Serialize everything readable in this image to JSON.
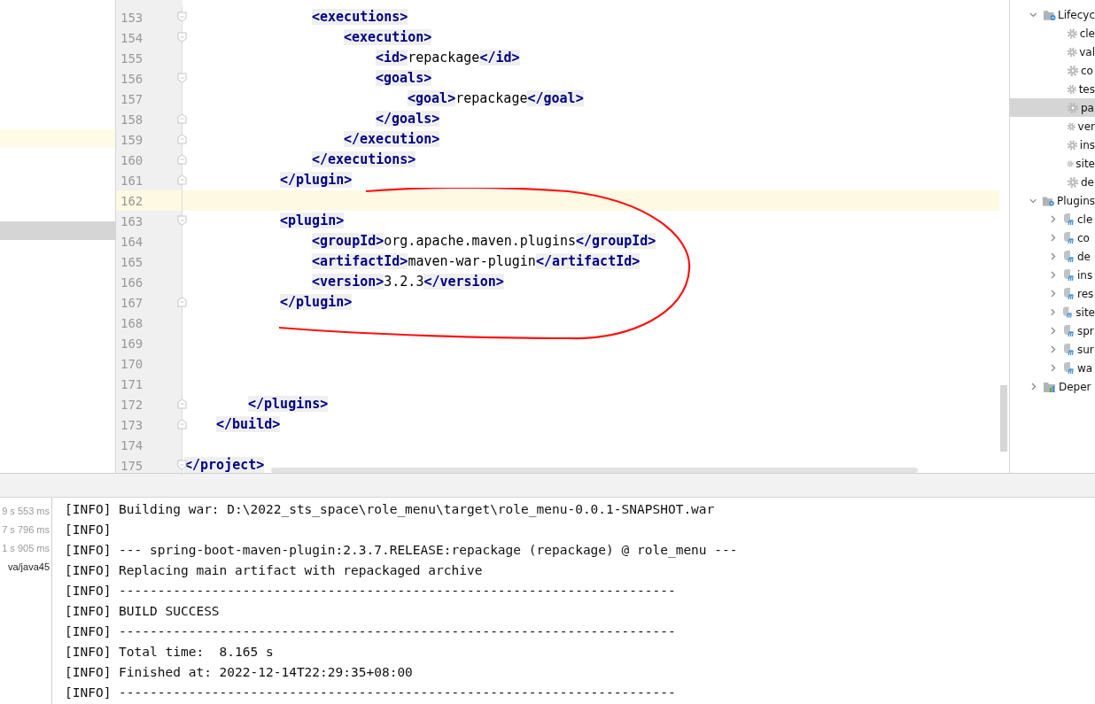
{
  "editor": {
    "lines": [
      {
        "kind": "group",
        "children": [
          {
            "kind": "group",
            "children": [
              {
                "kind": "group",
                "children": [
                  {
                    "kind": "group",
                    "children": [
                      {
                        "kind": "line",
                        "number": "153",
                        "fold_start": true,
                        "fold_end": false,
                        "current": false,
                        "tokens": [
                          {
                            "kind": "tag",
                            "text": "<executions>"
                          }
                        ],
                        "children": [
                          {
                            "kind": "line",
                            "number": "154",
                            "fold_start": true,
                            "fold_end": false,
                            "current": false,
                            "tokens": [
                              {
                                "kind": "tag",
                                "text": "<execution>"
                              }
                            ],
                            "children": [
                              {
                                "kind": "line",
                                "number": "155",
                                "fold_start": false,
                                "fold_end": false,
                                "current": false,
                                "tokens": [
                                  {
                                    "kind": "tag",
                                    "text": "<id>"
                                  },
                                  {
                                    "kind": "text",
                                    "text": "repackage"
                                  },
                                  {
                                    "kind": "tag",
                                    "text": "</id>"
                                  }
                                ]
                              },
                              {
                                "kind": "line",
                                "number": "156",
                                "fold_start": true,
                                "fold_end": false,
                                "current": false,
                                "tokens": [
                                  {
                                    "kind": "tag",
                                    "text": "<goals>"
                                  }
                                ],
                                "children": [
                                  {
                                    "kind": "line",
                                    "number": "157",
                                    "fold_start": false,
                                    "fold_end": false,
                                    "current": false,
                                    "tokens": [
                                      {
                                        "kind": "tag",
                                        "text": "<goal>"
                                      },
                                      {
                                        "kind": "text",
                                        "text": "repackage"
                                      },
                                      {
                                        "kind": "tag",
                                        "text": "</goal>"
                                      }
                                    ]
                                  }
                                ]
                              },
                              {
                                "kind": "line",
                                "number": "158",
                                "fold_start": false,
                                "fold_end": true,
                                "current": false,
                                "tokens": [
                                  {
                                    "kind": "tag",
                                    "text": "</goals>"
                                  }
                                ]
                              }
                            ]
                          },
                          {
                            "kind": "line",
                            "number": "159",
                            "fold_start": false,
                            "fold_end": true,
                            "current": false,
                            "tokens": [
                              {
                                "kind": "tag",
                                "text": "</execution>"
                              }
                            ]
                          }
                        ]
                      },
                      {
                        "kind": "line",
                        "number": "160",
                        "fold_start": false,
                        "fold_end": true,
                        "current": false,
                        "tokens": [
                          {
                            "kind": "tag",
                            "text": "</executions>"
                          }
                        ]
                      }
                    ]
                  },
                  {
                    "kind": "line",
                    "number": "161",
                    "fold_start": false,
                    "fold_end": true,
                    "current": false,
                    "tokens": [
                      {
                        "kind": "tag",
                        "text": "</plugin>"
                      }
                    ]
                  },
                  {
                    "kind": "line",
                    "number": "162",
                    "fold_start": false,
                    "fold_end": false,
                    "current": true
                  },
                  {
                    "kind": "line",
                    "number": "163",
                    "fold_start": true,
                    "fold_end": false,
                    "current": false,
                    "tokens": [
                      {
                        "kind": "tag",
                        "text": "<plugin>"
                      }
                    ],
                    "children": [
                      {
                        "kind": "line",
                        "number": "164",
                        "fold_start": false,
                        "fold_end": false,
                        "current": false,
                        "tokens": [
                          {
                            "kind": "tag",
                            "text": "<groupId>"
                          },
                          {
                            "kind": "text",
                            "text": "org.apache.maven.plugins"
                          },
                          {
                            "kind": "tag",
                            "text": "</groupId>"
                          }
                        ]
                      },
                      {
                        "kind": "line",
                        "number": "165",
                        "fold_start": false,
                        "fold_end": false,
                        "current": false,
                        "tokens": [
                          {
                            "kind": "tag",
                            "text": "<artifactId>"
                          },
                          {
                            "kind": "text",
                            "text": "maven-war-plugin"
                          },
                          {
                            "kind": "tag",
                            "text": "</artifactId>"
                          }
                        ]
                      },
                      {
                        "kind": "line",
                        "number": "166",
                        "fold_start": false,
                        "fold_end": false,
                        "current": false,
                        "tokens": [
                          {
                            "kind": "tag",
                            "text": "<version>"
                          },
                          {
                            "kind": "text",
                            "text": "3.2.3"
                          },
                          {
                            "kind": "tag",
                            "text": "</version>"
                          }
                        ]
                      }
                    ]
                  },
                  {
                    "kind": "line",
                    "number": "167",
                    "fold_start": false,
                    "fold_end": true,
                    "current": false,
                    "tokens": [
                      {
                        "kind": "tag",
                        "text": "</plugin>"
                      }
                    ]
                  },
                  {
                    "kind": "line",
                    "number": "168",
                    "fold_start": false,
                    "fold_end": false,
                    "current": false
                  },
                  {
                    "kind": "line",
                    "number": "169",
                    "fold_start": false,
                    "fold_end": false,
                    "current": false
                  },
                  {
                    "kind": "line",
                    "number": "170",
                    "fold_start": false,
                    "fold_end": false,
                    "current": false
                  },
                  {
                    "kind": "line",
                    "number": "171",
                    "fold_start": false,
                    "fold_end": false,
                    "current": false
                  }
                ]
              },
              {
                "kind": "line",
                "number": "172",
                "fold_start": false,
                "fold_end": true,
                "current": false,
                "tokens": [
                  {
                    "kind": "tag",
                    "text": "</plugins>"
                  }
                ]
              }
            ]
          },
          {
            "kind": "line",
            "number": "173",
            "fold_start": false,
            "fold_end": true,
            "current": false,
            "tokens": [
              {
                "kind": "tag",
                "text": "</build>"
              }
            ]
          },
          {
            "kind": "line",
            "number": "174",
            "fold_start": false,
            "fold_end": false,
            "current": false
          }
        ]
      },
      {
        "kind": "line",
        "number": "175",
        "fold_start": true,
        "fold_end": false,
        "current": false,
        "tokens": [
          {
            "kind": "tag",
            "text": "</project>"
          }
        ]
      }
    ]
  },
  "maven_tree": [
    {
      "label": "Lifecyc",
      "kind": "lifecycle",
      "expanded": true,
      "selected": false,
      "children": [
        {
          "label": "cle",
          "kind": "goal",
          "selected": false
        },
        {
          "label": "val",
          "kind": "goal",
          "selected": false
        },
        {
          "label": "co",
          "kind": "goal",
          "selected": false
        },
        {
          "label": "tes",
          "kind": "goal",
          "selected": false
        },
        {
          "label": "pa",
          "kind": "goal",
          "selected": true
        },
        {
          "label": "ver",
          "kind": "goal",
          "selected": false
        },
        {
          "label": "ins",
          "kind": "goal",
          "selected": false
        },
        {
          "label": "site",
          "kind": "goal",
          "selected": false
        },
        {
          "label": "de",
          "kind": "goal",
          "selected": false
        }
      ]
    },
    {
      "label": "Plugins",
      "kind": "plugins",
      "expanded": true,
      "selected": false,
      "children": [
        {
          "label": "cle",
          "kind": "plugin",
          "expanded": false,
          "selected": false
        },
        {
          "label": "co",
          "kind": "plugin",
          "expanded": false,
          "selected": false
        },
        {
          "label": "de",
          "kind": "plugin",
          "expanded": false,
          "selected": false
        },
        {
          "label": "ins",
          "kind": "plugin",
          "expanded": false,
          "selected": false
        },
        {
          "label": "res",
          "kind": "plugin",
          "expanded": false,
          "selected": false
        },
        {
          "label": "site",
          "kind": "plugin",
          "expanded": false,
          "selected": false
        },
        {
          "label": "spr",
          "kind": "plugin",
          "expanded": false,
          "selected": false
        },
        {
          "label": "sur",
          "kind": "plugin",
          "expanded": false,
          "selected": false
        },
        {
          "label": "wa",
          "kind": "plugin",
          "expanded": false,
          "selected": false
        }
      ]
    },
    {
      "label": "Deper",
      "kind": "dependencies",
      "expanded": false,
      "selected": false
    }
  ],
  "run_tree": [
    {
      "text": "9 s 553 ms",
      "kind": "time"
    },
    {
      "text": "7 s 796 ms",
      "kind": "time"
    },
    {
      "text": "1 s 905 ms",
      "kind": "time"
    },
    {
      "text": "va/java45",
      "kind": "path"
    }
  ],
  "console": [
    "[INFO] Building war: D:\\2022_sts_space\\role_menu\\target\\role_menu-0.0.1-SNAPSHOT.war",
    "[INFO]",
    "[INFO] --- spring-boot-maven-plugin:2.3.7.RELEASE:repackage (repackage) @ role_menu ---",
    "[INFO] Replacing main artifact with repackaged archive",
    "[INFO] ------------------------------------------------------------------------",
    "[INFO] BUILD SUCCESS",
    "[INFO] ------------------------------------------------------------------------",
    "[INFO] Total time:  8.165 s",
    "[INFO] Finished at: 2022-12-14T22:29:35+08:00",
    "[INFO] ------------------------------------------------------------------------"
  ]
}
